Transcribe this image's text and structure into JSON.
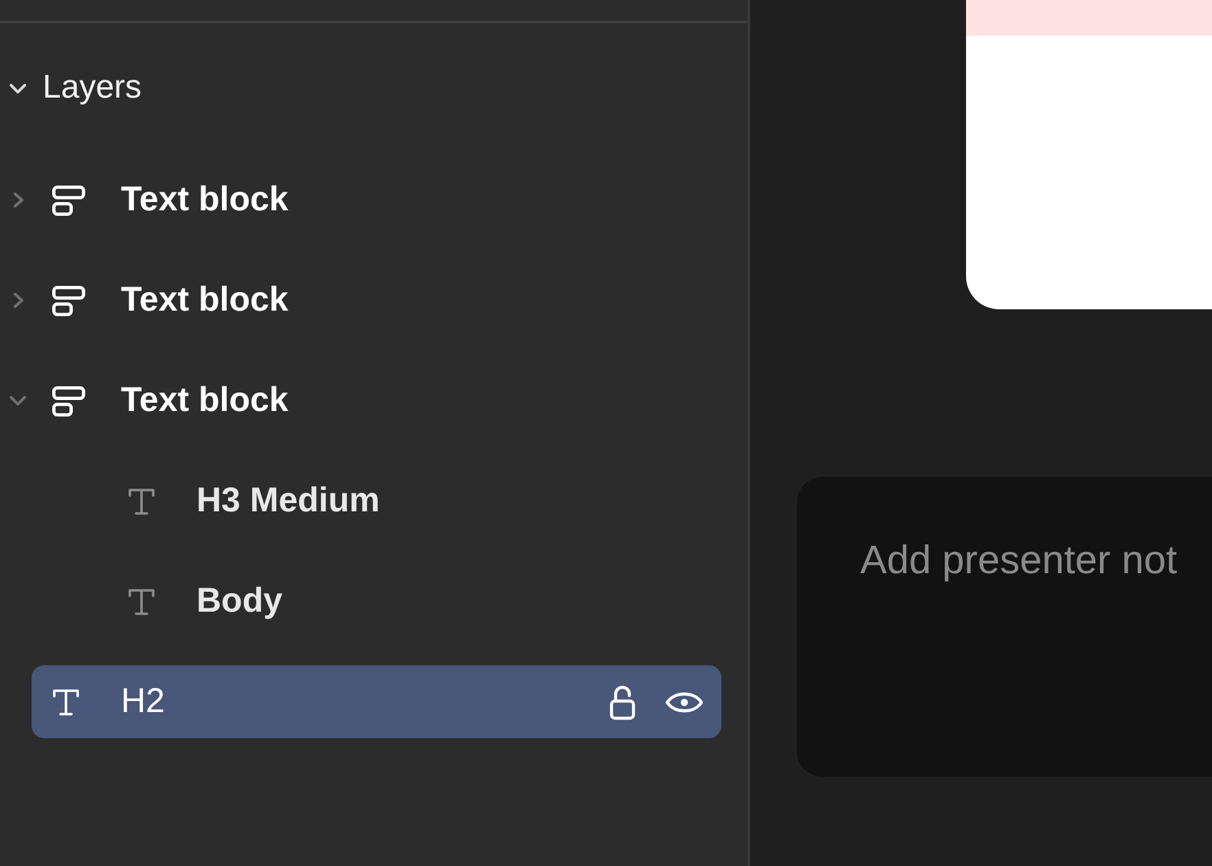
{
  "layers_panel": {
    "header": {
      "title": "Layers",
      "expanded": true
    },
    "items": [
      {
        "kind": "block",
        "label": "Text block",
        "expanded": false,
        "selected": false
      },
      {
        "kind": "block",
        "label": "Text block",
        "expanded": false,
        "selected": false
      },
      {
        "kind": "block",
        "label": "Text block",
        "expanded": true,
        "selected": false,
        "children": [
          {
            "kind": "text",
            "label": "H3 Medium",
            "selected": false
          },
          {
            "kind": "text",
            "label": "Body",
            "selected": false
          }
        ]
      },
      {
        "kind": "text",
        "label": "H2",
        "selected": true
      }
    ]
  },
  "notes": {
    "placeholder": "Add presenter not"
  }
}
